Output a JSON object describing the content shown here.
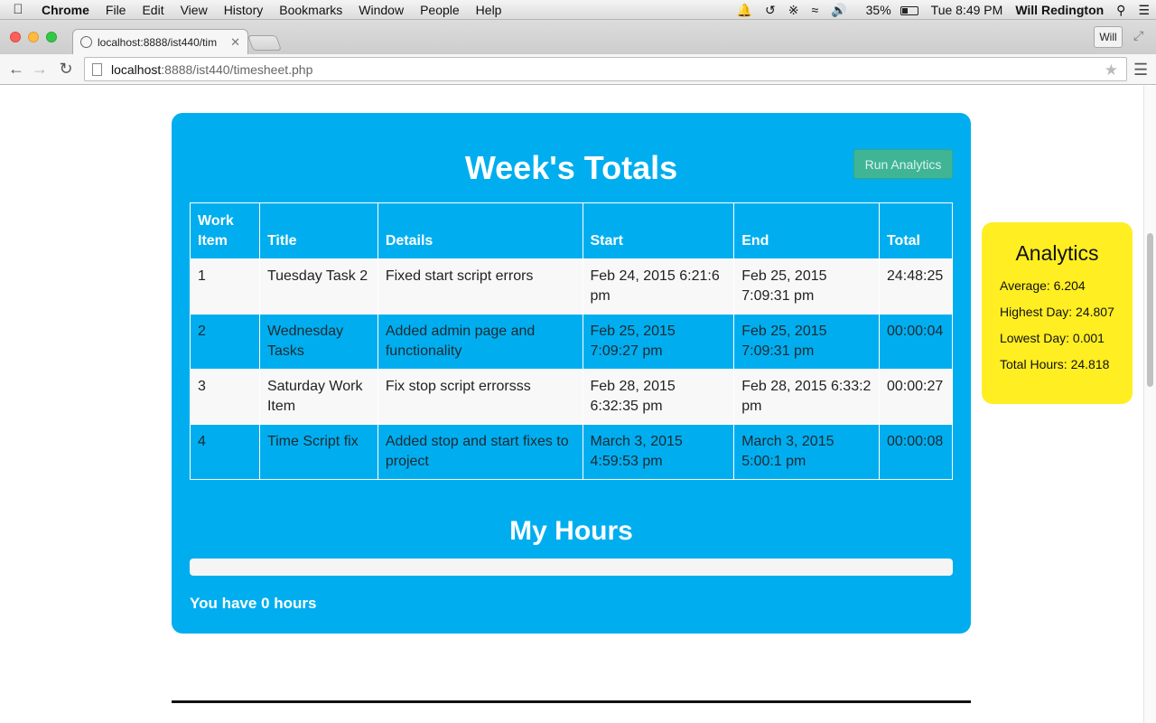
{
  "menubar": {
    "app_name": "Chrome",
    "items": [
      "File",
      "Edit",
      "View",
      "History",
      "Bookmarks",
      "Window",
      "People",
      "Help"
    ],
    "battery": "35%",
    "clock": "Tue 8:49 PM",
    "user": "Will Redington"
  },
  "browser": {
    "tab_title": "localhost:8888/ist440/tim",
    "profile_label": "Will",
    "url_host": "localhost",
    "url_rest": ":8888/ist440/timesheet.php"
  },
  "page": {
    "title": "Week's Totals",
    "run_button": "Run Analytics",
    "table": {
      "headers": [
        "Work Item",
        "Title",
        "Details",
        "Start",
        "End",
        "Total"
      ],
      "rows": [
        {
          "work_item": "1",
          "title": "Tuesday Task 2",
          "details": "Fixed start script errors",
          "start": "Feb 24, 2015 6:21:6 pm",
          "end": "Feb 25, 2015 7:09:31 pm",
          "total": "24:48:25"
        },
        {
          "work_item": "2",
          "title": "Wednesday Tasks",
          "details": "Added admin page and functionality",
          "start": "Feb 25, 2015 7:09:27 pm",
          "end": "Feb 25, 2015 7:09:31 pm",
          "total": "00:00:04"
        },
        {
          "work_item": "3",
          "title": "Saturday Work Item",
          "details": "Fix stop script errorsss",
          "start": "Feb 28, 2015 6:32:35 pm",
          "end": "Feb 28, 2015 6:33:2 pm",
          "total": "00:00:27"
        },
        {
          "work_item": "4",
          "title": "Time Script fix",
          "details": "Added stop and start fixes to project",
          "start": "March 3, 2015 4:59:53 pm",
          "end": "March 3, 2015 5:00:1 pm",
          "total": "00:00:08"
        }
      ]
    },
    "hours_title": "My Hours",
    "hours_progress": 0,
    "hours_text": "You have 0 hours"
  },
  "analytics": {
    "title": "Analytics",
    "average": "Average: 6.204",
    "highest": "Highest Day: 24.807",
    "lowest": "Lowest Day: 0.001",
    "total": "Total Hours: 24.818"
  },
  "colors": {
    "panel": "#00aeef",
    "analytics": "#ffee22",
    "button": "#3fb596"
  }
}
